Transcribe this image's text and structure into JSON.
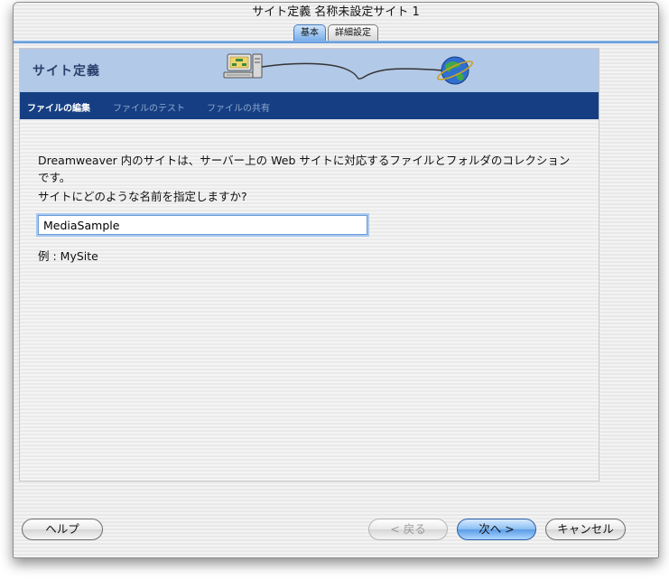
{
  "window": {
    "title": "サイト定義 名称未設定サイト 1"
  },
  "tabs": [
    {
      "label": "基本",
      "active": true
    },
    {
      "label": "詳細設定",
      "active": false
    }
  ],
  "banner": {
    "title": "サイト定義"
  },
  "steps": [
    {
      "label": "ファイルの編集",
      "active": true
    },
    {
      "label": "ファイルのテスト",
      "active": false
    },
    {
      "label": "ファイルの共有",
      "active": false
    }
  ],
  "content": {
    "intro": "Dreamweaver 内のサイトは、サーバー上の Web サイトに対応するファイルとフォルダのコレクションです。",
    "question": "サイトにどのような名前を指定しますか?",
    "site_name_value": "MediaSample",
    "example": "例 : MySite"
  },
  "buttons": {
    "help": "ヘルプ",
    "back": "< 戻る",
    "next": "次へ >",
    "cancel": "キャンセル"
  },
  "colors": {
    "banner": "#b3c9e8",
    "subnav": "#163f83",
    "primary_button": "#5b9ce6"
  },
  "icons": [
    "computer-icon",
    "globe-icon"
  ]
}
